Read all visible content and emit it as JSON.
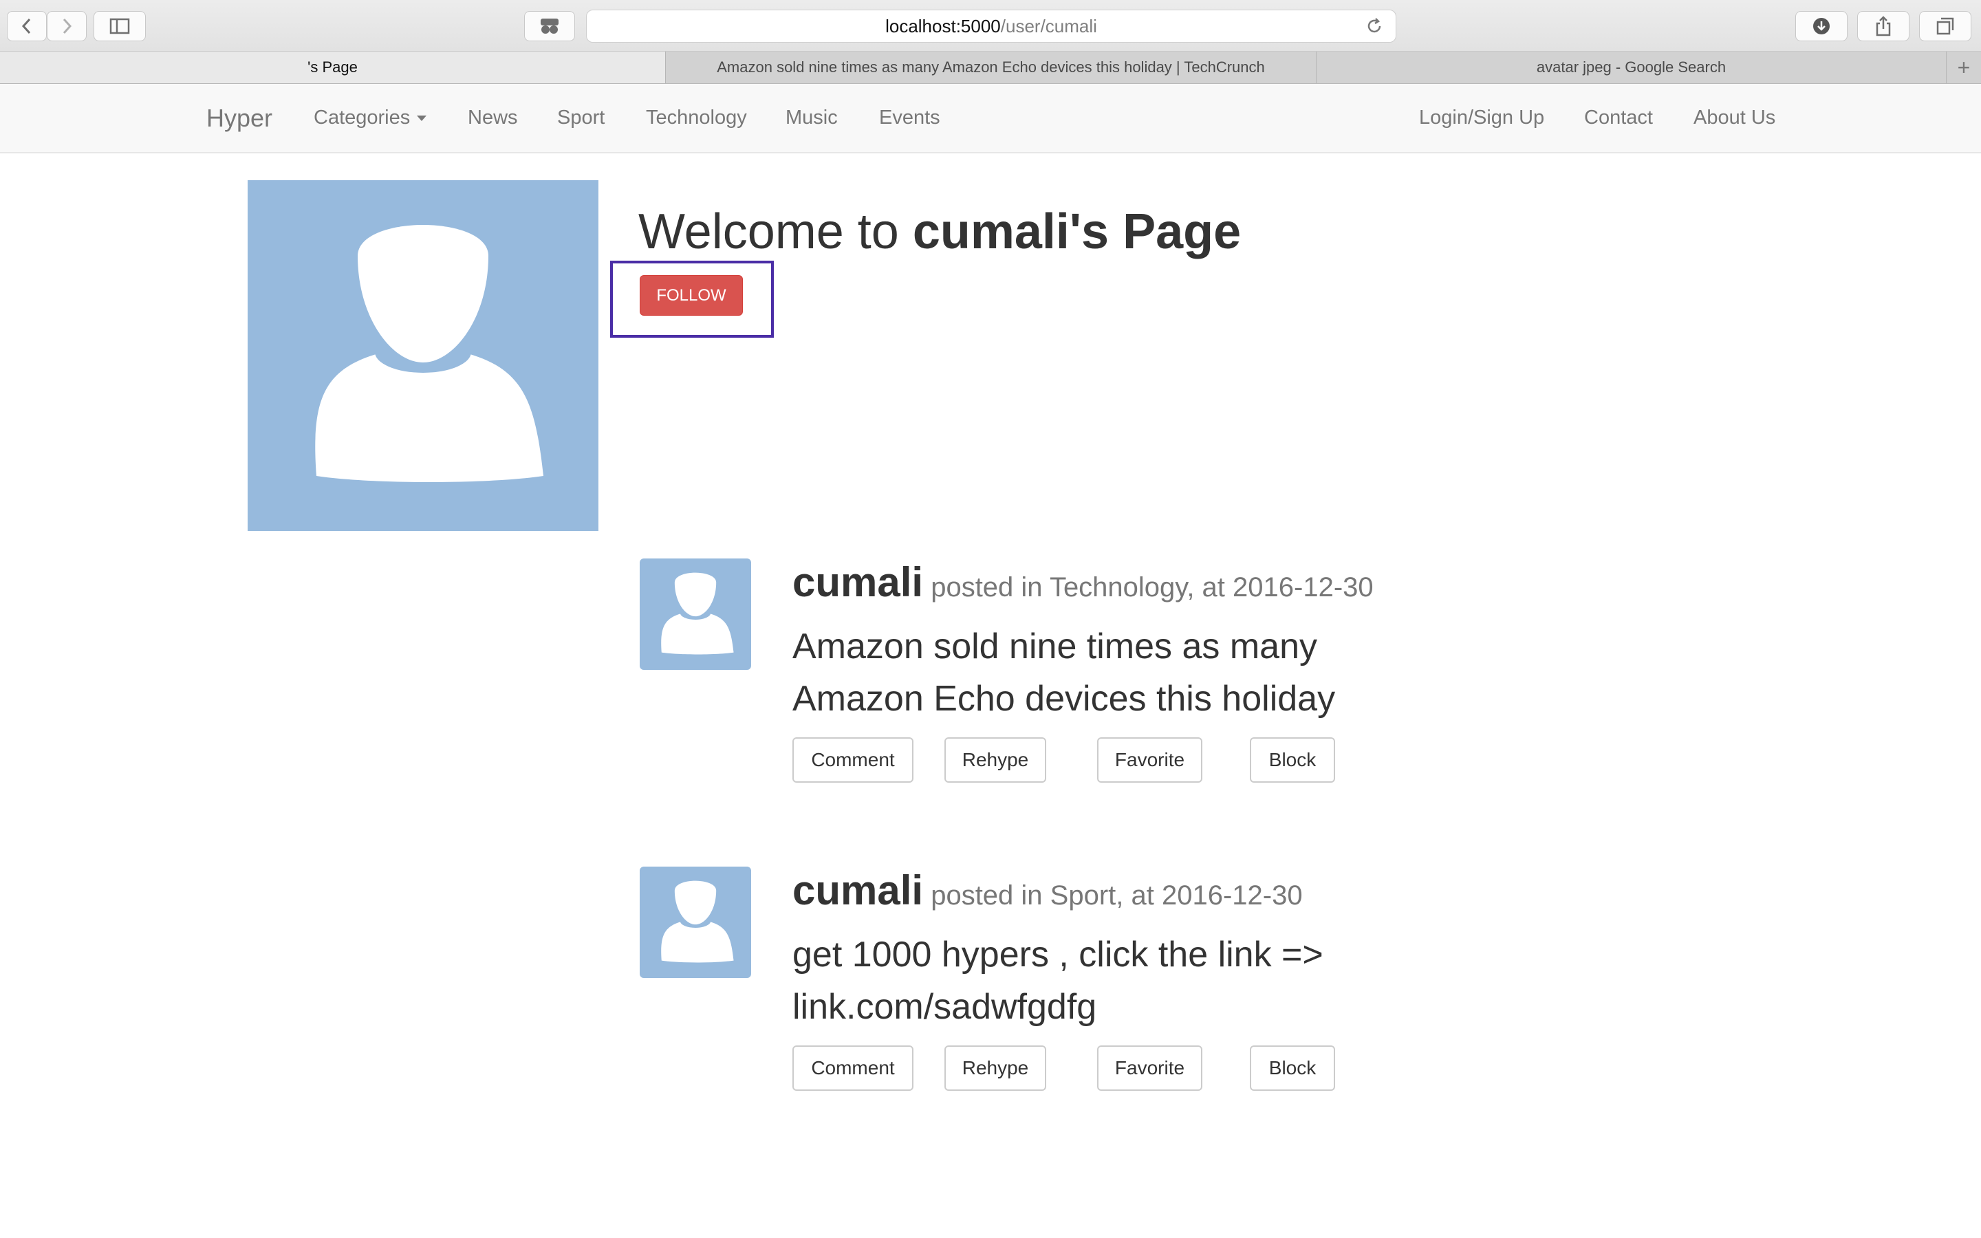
{
  "browser": {
    "url_host": "localhost:5000",
    "url_path": "/user/cumali",
    "tabs": [
      {
        "title": "'s Page",
        "active": true
      },
      {
        "title": "Amazon sold nine times as many Amazon Echo devices this holiday | TechCrunch",
        "active": false
      },
      {
        "title": "avatar jpeg - Google Search",
        "active": false
      }
    ],
    "new_tab_symbol": "+"
  },
  "navbar": {
    "brand": "Hyper",
    "left_links": [
      "Categories",
      "News",
      "Sport",
      "Technology",
      "Music",
      "Events"
    ],
    "right_links": [
      "Login/Sign Up",
      "Contact",
      "About Us"
    ]
  },
  "profile": {
    "welcome_prefix": "Welcome to ",
    "welcome_name": "cumali's Page",
    "follow_label": "FOLLOW",
    "avatar_color": "#97badd"
  },
  "posts": [
    {
      "user": "cumali",
      "meta": "posted in Technology, at 2016-12-30",
      "body": "Amazon sold nine times as many Amazon Echo devices this holiday",
      "actions": [
        "Comment",
        "Rehype",
        "Favorite",
        "Block"
      ]
    },
    {
      "user": "cumali",
      "meta": "posted in Sport, at 2016-12-30",
      "body": "get 1000 hypers , click the link => link.com/sadwfgdfg",
      "actions": [
        "Comment",
        "Rehype",
        "Favorite",
        "Block"
      ]
    }
  ],
  "colors": {
    "follow_button": "#d9534f",
    "highlight_box": "#4a2da6",
    "navbar_bg": "#f8f8f8"
  }
}
